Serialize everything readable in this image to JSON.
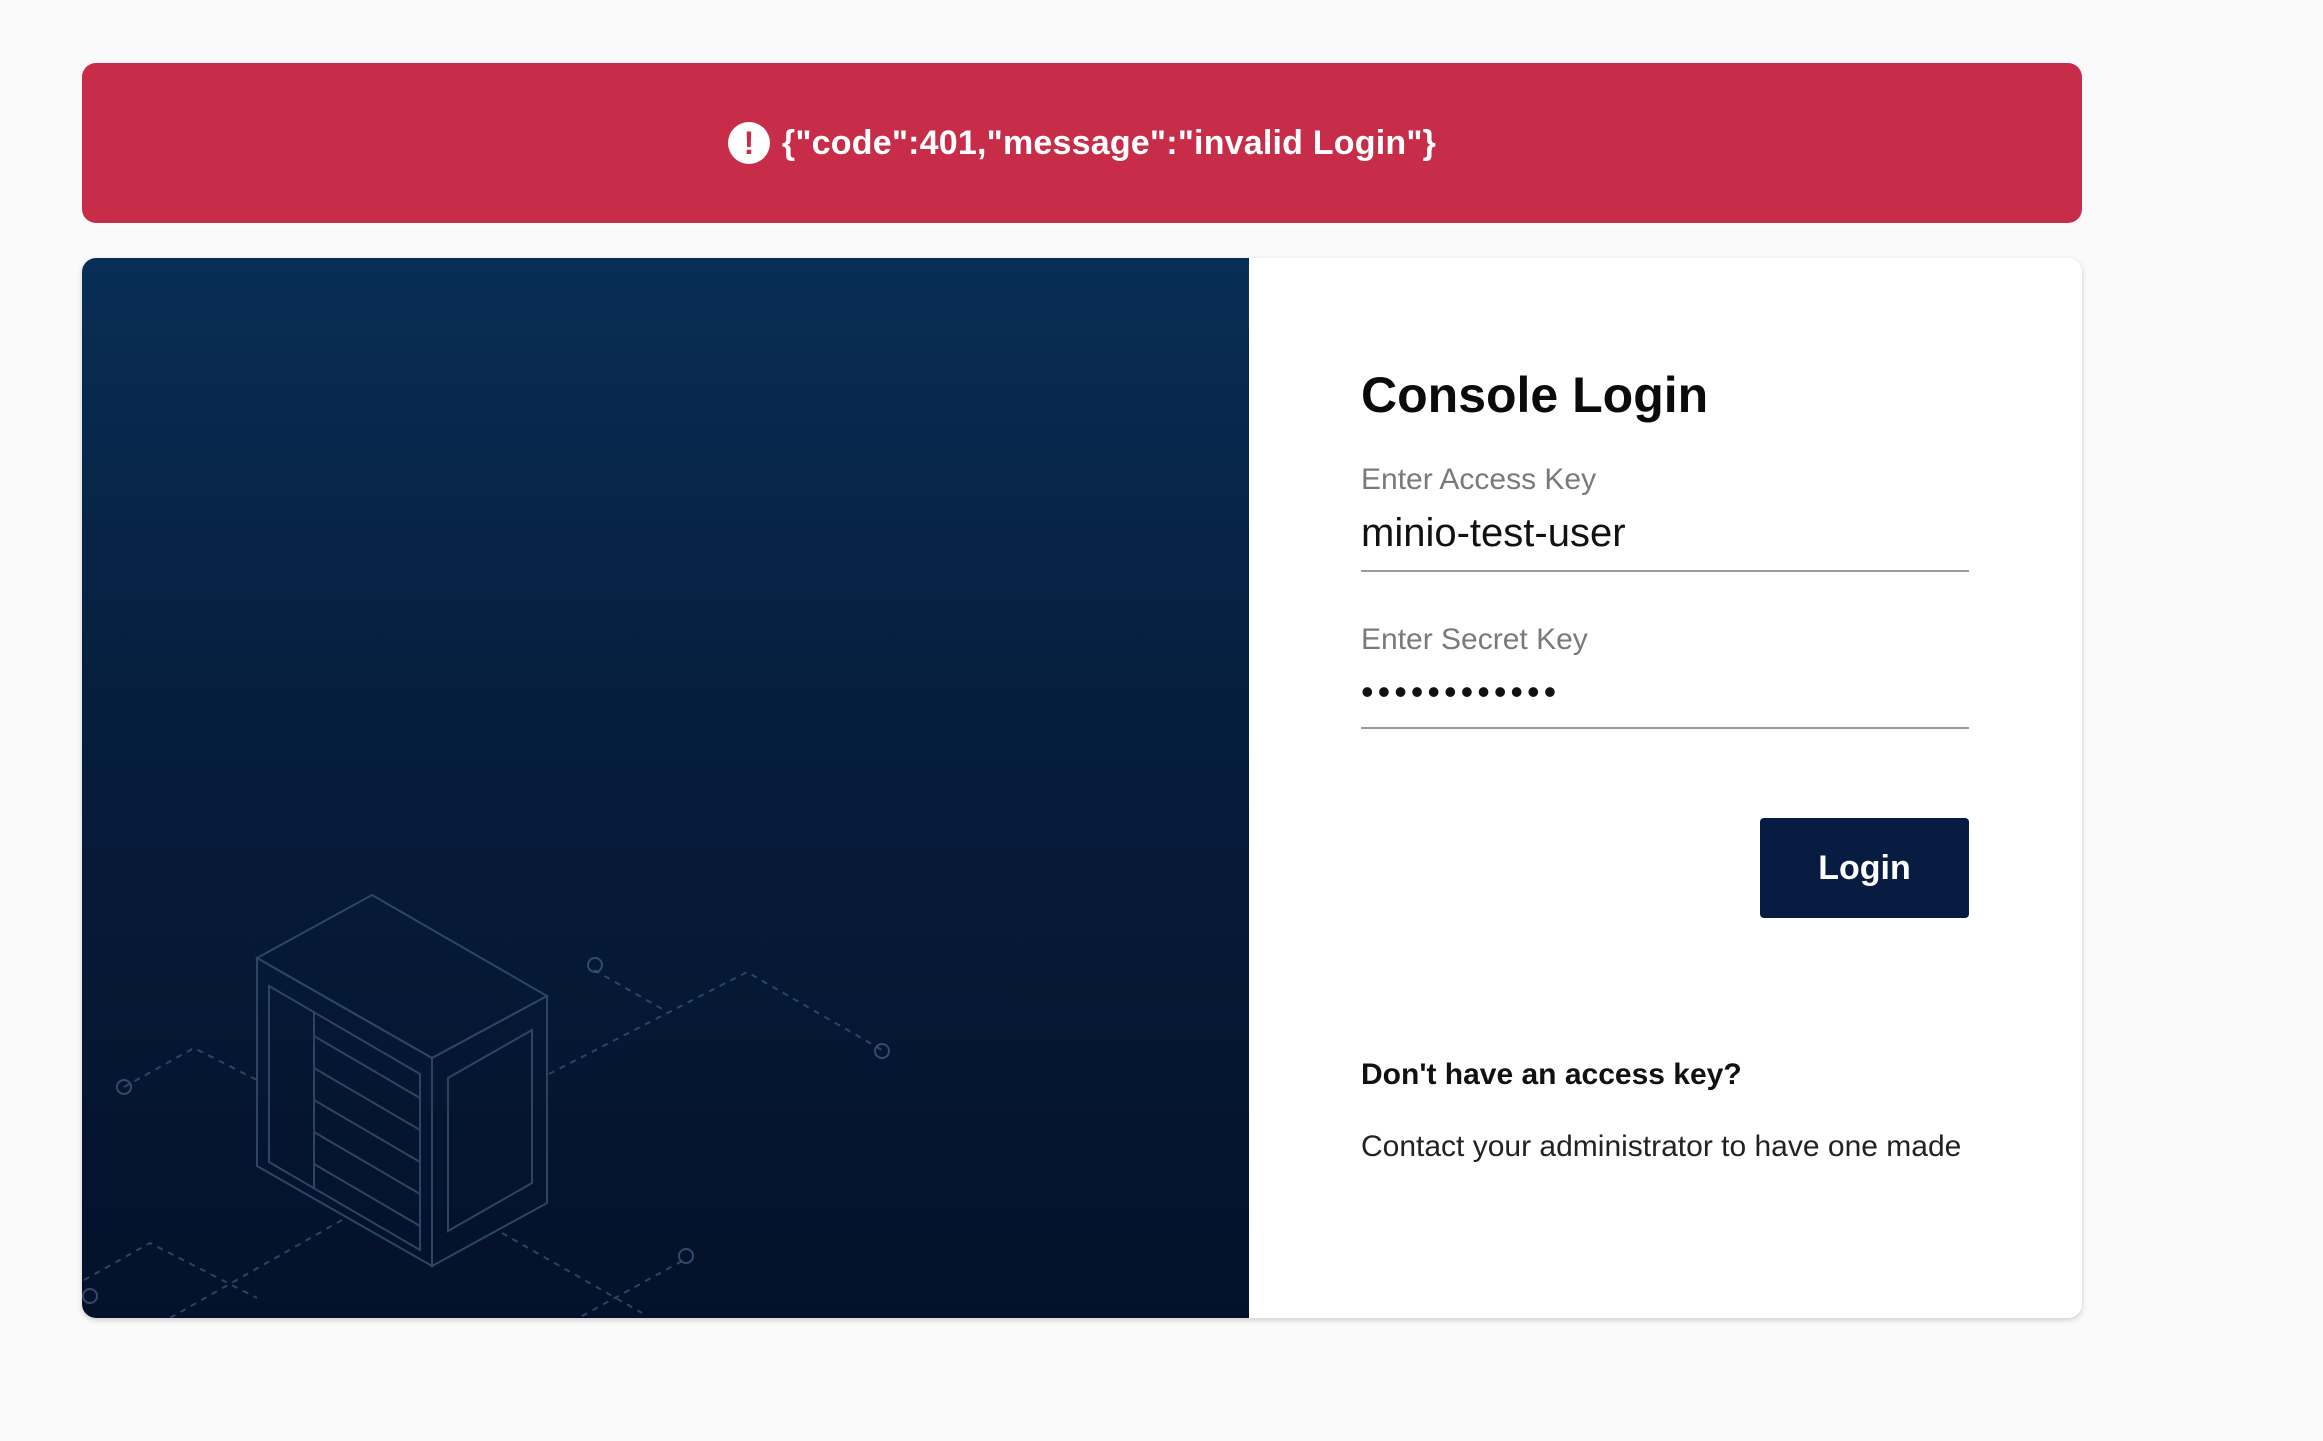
{
  "error_banner": {
    "icon": "exclamation-circle-icon",
    "message": "{\"code\":401,\"message\":\"invalid Login\"}",
    "color": "#c72c48"
  },
  "login": {
    "title": "Console Login",
    "access_key": {
      "label": "Enter Access Key",
      "value": "minio-test-user"
    },
    "secret_key": {
      "label": "Enter Secret Key",
      "value": "••••••••••••"
    },
    "login_label": "Login",
    "help_title": "Don't have an access key?",
    "help_text": "Contact your administrator to have one made"
  },
  "colors": {
    "page_background": "#fafafa",
    "hero_gradient_top": "#082e56",
    "hero_gradient_bottom": "#04112a",
    "button": "#081c42"
  }
}
